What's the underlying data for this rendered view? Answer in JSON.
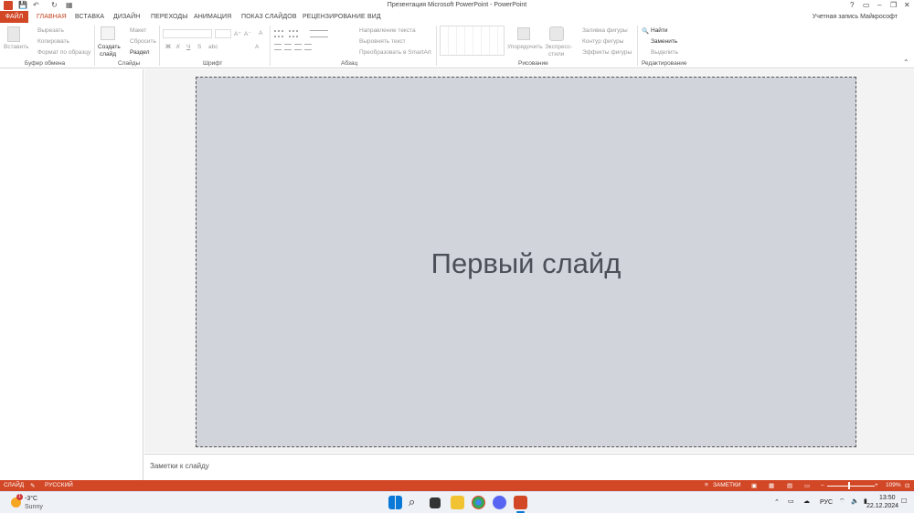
{
  "window": {
    "title": "Презентация Microsoft PowerPoint - PowerPoint",
    "help": "?",
    "minimize": "–",
    "restore": "❐",
    "close": "✕"
  },
  "qat": {
    "save": "💾",
    "undo": "↶",
    "redo": "↻",
    "present": "▦"
  },
  "tabs": {
    "file": "ФАЙЛ",
    "home": "ГЛАВНАЯ",
    "insert": "ВСТАВКА",
    "design": "ДИЗАЙН",
    "transitions": "ПЕРЕХОДЫ",
    "animation": "АНИМАЦИЯ",
    "slideshow": "ПОКАЗ СЛАЙДОВ",
    "review": "РЕЦЕНЗИРОВАНИЕ",
    "view": "ВИД"
  },
  "account": "Учетная запись Майкрософт",
  "ribbon": {
    "clipboard": {
      "label": "Буфер обмена",
      "paste": "Вставить",
      "cut": "Вырезать",
      "copy": "Копировать",
      "format_painter": "Формат по образцу"
    },
    "slides": {
      "label": "Слайды",
      "new_slide_1": "Создать",
      "new_slide_2": "слайд",
      "layout": "Макет",
      "reset": "Сбросить",
      "section": "Раздел"
    },
    "font": {
      "label": "Шрифт",
      "bold": "Ж",
      "italic": "К",
      "underline": "Ч",
      "strike": "S",
      "shadow": "abc",
      "size_up": "A⁺",
      "size_down": "A⁻",
      "clear": "A"
    },
    "paragraph": {
      "label": "Абзац",
      "text_direction": "Направление текста",
      "align_text": "Выровнять текст",
      "smartart": "Преобразовать в SmartArt"
    },
    "drawing": {
      "label": "Рисование",
      "arrange": "Упорядочить",
      "quick_styles_1": "Экспресс-",
      "quick_styles_2": "стили",
      "shape_fill": "Заливка фигуры",
      "shape_outline": "Контур фигуры",
      "shape_effects": "Эффекты фигуры"
    },
    "editing": {
      "label": "Редактирование",
      "find": "Найти",
      "replace": "Заменить",
      "select": "Выделить"
    }
  },
  "slide": {
    "title": "Первый слайд"
  },
  "notes": {
    "placeholder": "Заметки к слайду"
  },
  "status": {
    "slide": "СЛАЙД",
    "language": "РУССКИЙ",
    "notes": "ЗАМЕТКИ",
    "zoom": "109%"
  },
  "taskbar": {
    "weather_temp": "-3°C",
    "weather_desc": "Sunny",
    "tray_lang": "РУС",
    "time": "13:50",
    "date": "22.12.2024",
    "badge": "1"
  },
  "colors": {
    "accent": "#d24726",
    "slide_bg": "#d1d4db"
  }
}
